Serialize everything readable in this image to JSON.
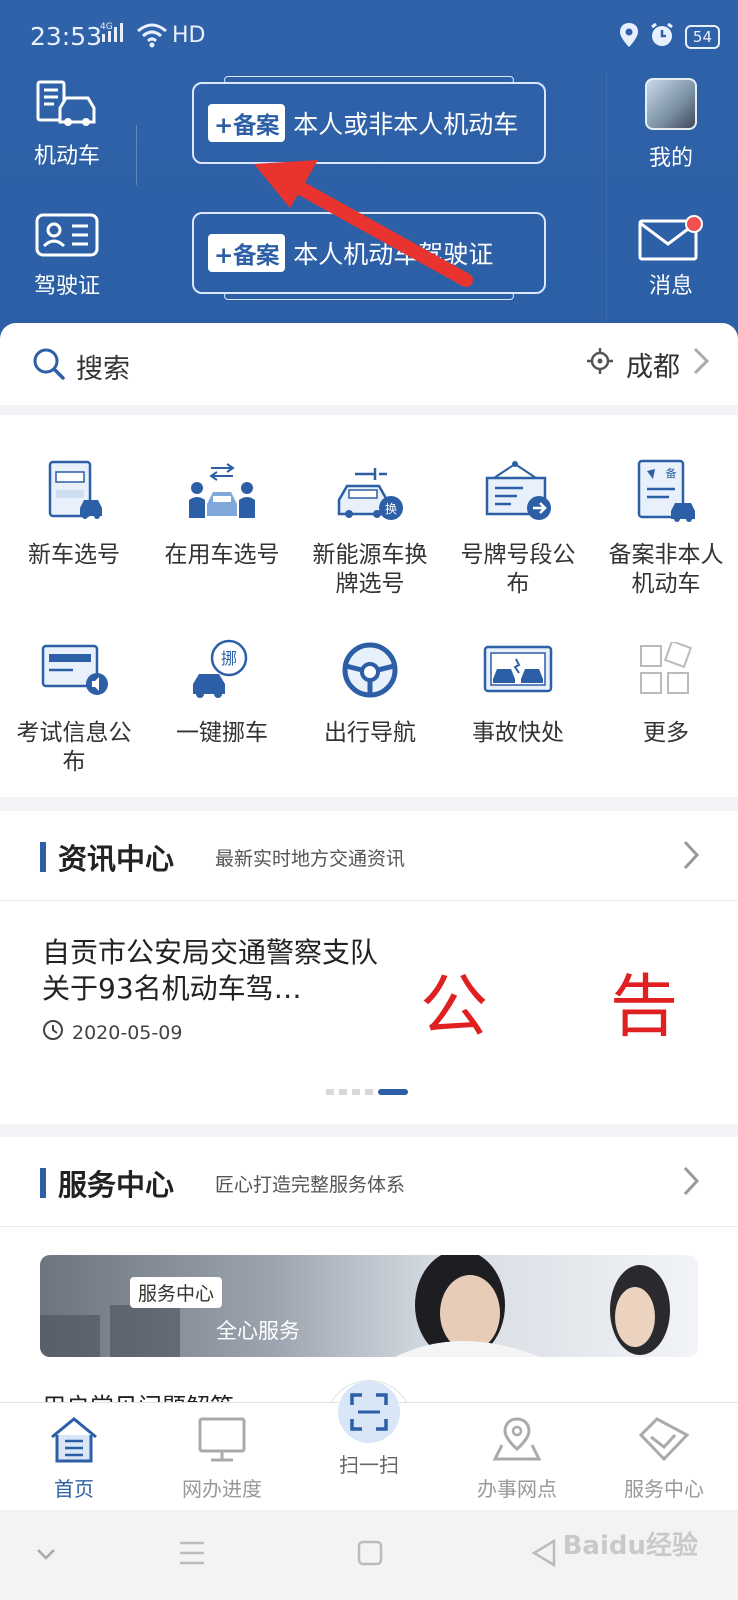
{
  "status_bar": {
    "time": "23:53",
    "network": "4G",
    "hd": "HD",
    "battery": "54"
  },
  "header": {
    "vehicle_label": "机动车",
    "license_label": "驾驶证",
    "profile_label": "我的",
    "messages_label": "消息",
    "banner1": {
      "tag": "+备案",
      "text": "本人或非本人机动车"
    },
    "banner2": {
      "tag": "+备案",
      "text": "本人机动车驾驶证"
    }
  },
  "search": {
    "placeholder": "搜索",
    "city": "成都"
  },
  "services": [
    {
      "label": "新车选号",
      "icon": "new-car-plate-icon"
    },
    {
      "label": "在用车选号",
      "icon": "car-owners-icon"
    },
    {
      "label": "新能源车换牌选号",
      "icon": "ev-car-swap-icon"
    },
    {
      "label": "号牌号段公布",
      "icon": "notice-board-icon"
    },
    {
      "label": "备案非本人机动车",
      "icon": "registration-doc-icon"
    },
    {
      "label": "考试信息公布",
      "icon": "exam-info-icon"
    },
    {
      "label": "一键挪车",
      "icon": "move-car-icon"
    },
    {
      "label": "出行导航",
      "icon": "steering-wheel-icon"
    },
    {
      "label": "事故快处",
      "icon": "accident-icon"
    },
    {
      "label": "更多",
      "icon": "more-grid-icon"
    }
  ],
  "news": {
    "title": "资讯中心",
    "subtitle": "最新实时地方交通资讯",
    "item_title": "自贡市公安局交通警察支队关于93名机动车驾…",
    "item_date": "2020-05-09",
    "poster_chars": [
      "公",
      "告"
    ]
  },
  "service_center": {
    "title": "服务中心",
    "subtitle": "匠心打造完整服务体系",
    "banner_tag": "服务中心",
    "banner_text": "全心服务",
    "faq_label": "用户常见问题解答"
  },
  "tabbar": [
    {
      "label": "首页",
      "active": true
    },
    {
      "label": "网办进度",
      "active": false
    },
    {
      "label": "扫一扫",
      "active": false
    },
    {
      "label": "办事网点",
      "active": false
    },
    {
      "label": "服务中心",
      "active": false
    }
  ],
  "watermark": "Baidu经验",
  "colors": {
    "primary": "#2c5fa5",
    "header_bg": "#2f62a8",
    "alert_red": "#e02020",
    "arrow_red": "#e8332f"
  }
}
